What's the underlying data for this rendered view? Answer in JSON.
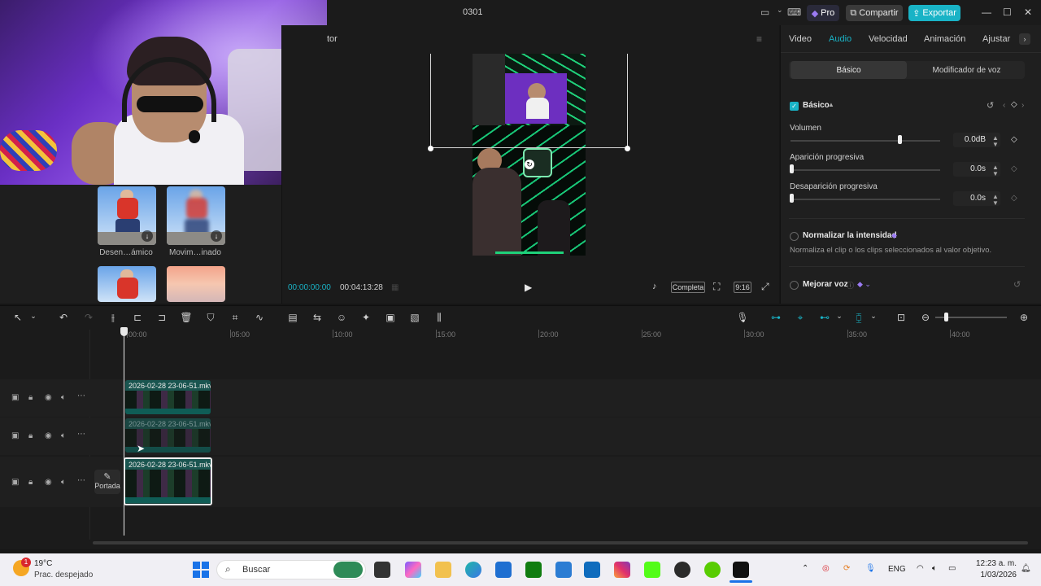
{
  "window": {
    "title": "0301",
    "pro_label": "Pro",
    "share_label": "Compartir",
    "export_label": "Exportar"
  },
  "media": {
    "items": [
      {
        "label": "Desen…ámico"
      },
      {
        "label": "Movim…inado"
      }
    ]
  },
  "player": {
    "title_fragment": "tor",
    "current_time": "00:00:00:00",
    "total_time": "00:04:13:28",
    "complete_label": "Completa",
    "ratio_label": "9:16"
  },
  "right_panel": {
    "tabs": [
      "Video",
      "Audio",
      "Velocidad",
      "Animación",
      "Ajustar"
    ],
    "active_tab": "Audio",
    "subtabs": [
      "Básico",
      "Modificador de voz"
    ],
    "section_label": "Básico",
    "volume_label": "Volumen",
    "volume_value": "0.0dB",
    "volume_level": 0.73,
    "fade_in_label": "Aparición progresiva",
    "fade_in_value": "0.0s",
    "fade_out_label": "Desaparición progresiva",
    "fade_out_value": "0.0s",
    "normalize_label": "Normalizar la intensidad",
    "normalize_note": "Normaliza el clip o los clips seleccionados al valor objetivo.",
    "enhance_voice_label": "Mejorar voz"
  },
  "timeline": {
    "ruler": [
      "00:00",
      "05:00",
      "10:00",
      "15:00",
      "20:00",
      "25:00",
      "30:00",
      "35:00",
      "40:00"
    ],
    "clips": [
      {
        "name": "2026-02-28 23-06-51.mkv"
      },
      {
        "name": "2026-02-28 23-06-51.mkv"
      },
      {
        "name": "2026-02-28 23-06-51.mkv"
      }
    ],
    "cover_label": "Portada"
  },
  "taskbar": {
    "temperature": "19°C",
    "weather": "Prac. despejado",
    "weather_badge": "1",
    "search_placeholder": "Buscar",
    "language": "ENG",
    "time": "12:23 a. m.",
    "date": "1/03/2026"
  },
  "colors": {
    "accent": "#19b3c6",
    "background": "#1b1b1b"
  }
}
